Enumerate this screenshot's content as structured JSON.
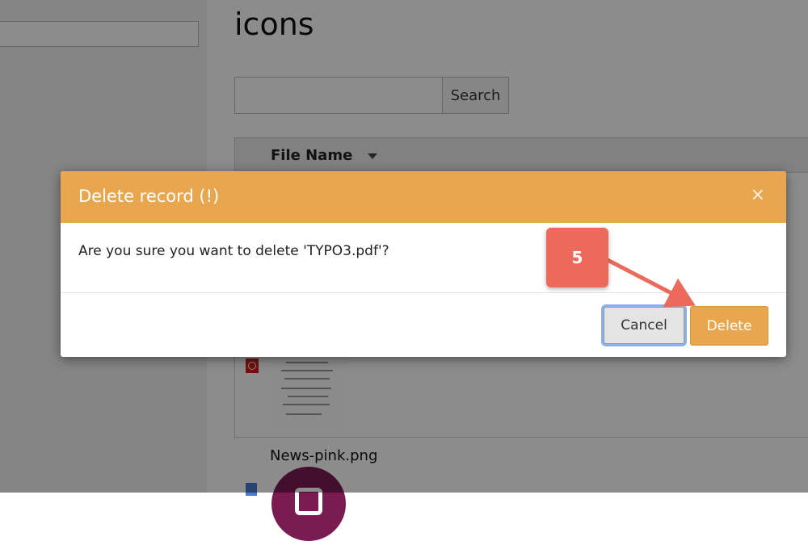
{
  "page": {
    "title": "icons",
    "search_button": "Search",
    "table": {
      "column_file_name": "File Name"
    },
    "rows": [
      {
        "file_name": "News-pink.png"
      }
    ]
  },
  "dialog": {
    "title": "Delete record (!)",
    "close_symbol": "×",
    "message": "Are you sure you want to delete 'TYPO3.pdf'?",
    "cancel_label": "Cancel",
    "delete_label": "Delete"
  },
  "annotation": {
    "step_number": "5"
  },
  "colors": {
    "dialog_header": "#e8a74f",
    "delete_button": "#e8a74f",
    "annotation": "#ec6a5c",
    "focus_ring": "#86b3ee"
  }
}
